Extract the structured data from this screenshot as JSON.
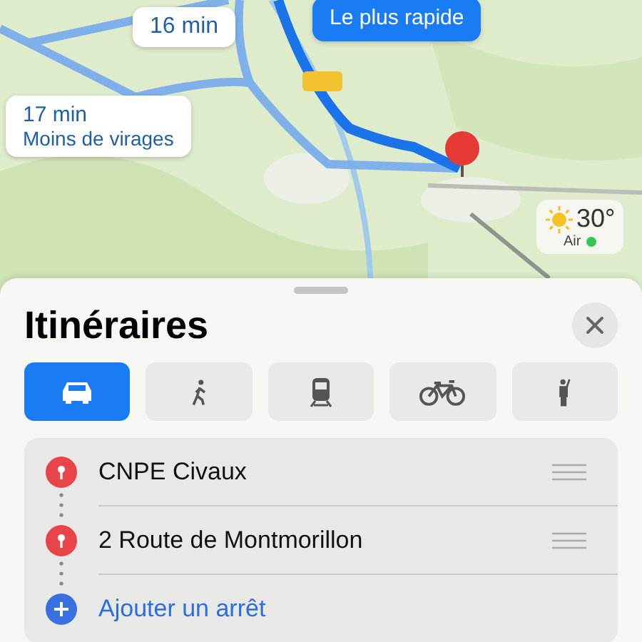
{
  "map": {
    "kind": "picture",
    "callouts": [
      {
        "time": "16 min",
        "selected": false
      },
      {
        "subtitle": "Le plus rapide",
        "selected": true
      },
      {
        "time": "17 min",
        "subtitle": "Moins de virages",
        "selected": false
      }
    ],
    "weather": {
      "temperature": "30°",
      "air": "Air"
    }
  },
  "sheet": {
    "title": "Itinéraires",
    "modes": [
      {
        "kind": "car",
        "selected": true
      },
      {
        "kind": "walk",
        "selected": false
      },
      {
        "kind": "transit",
        "selected": false
      },
      {
        "kind": "bike",
        "selected": false
      },
      {
        "kind": "ride",
        "selected": false
      }
    ],
    "stops": [
      {
        "kind": "pin",
        "label": "CNPE Civaux"
      },
      {
        "kind": "pin",
        "label": "2 Route de Montmorillon"
      },
      {
        "kind": "add",
        "label": "Ajouter un arrêt"
      }
    ]
  }
}
